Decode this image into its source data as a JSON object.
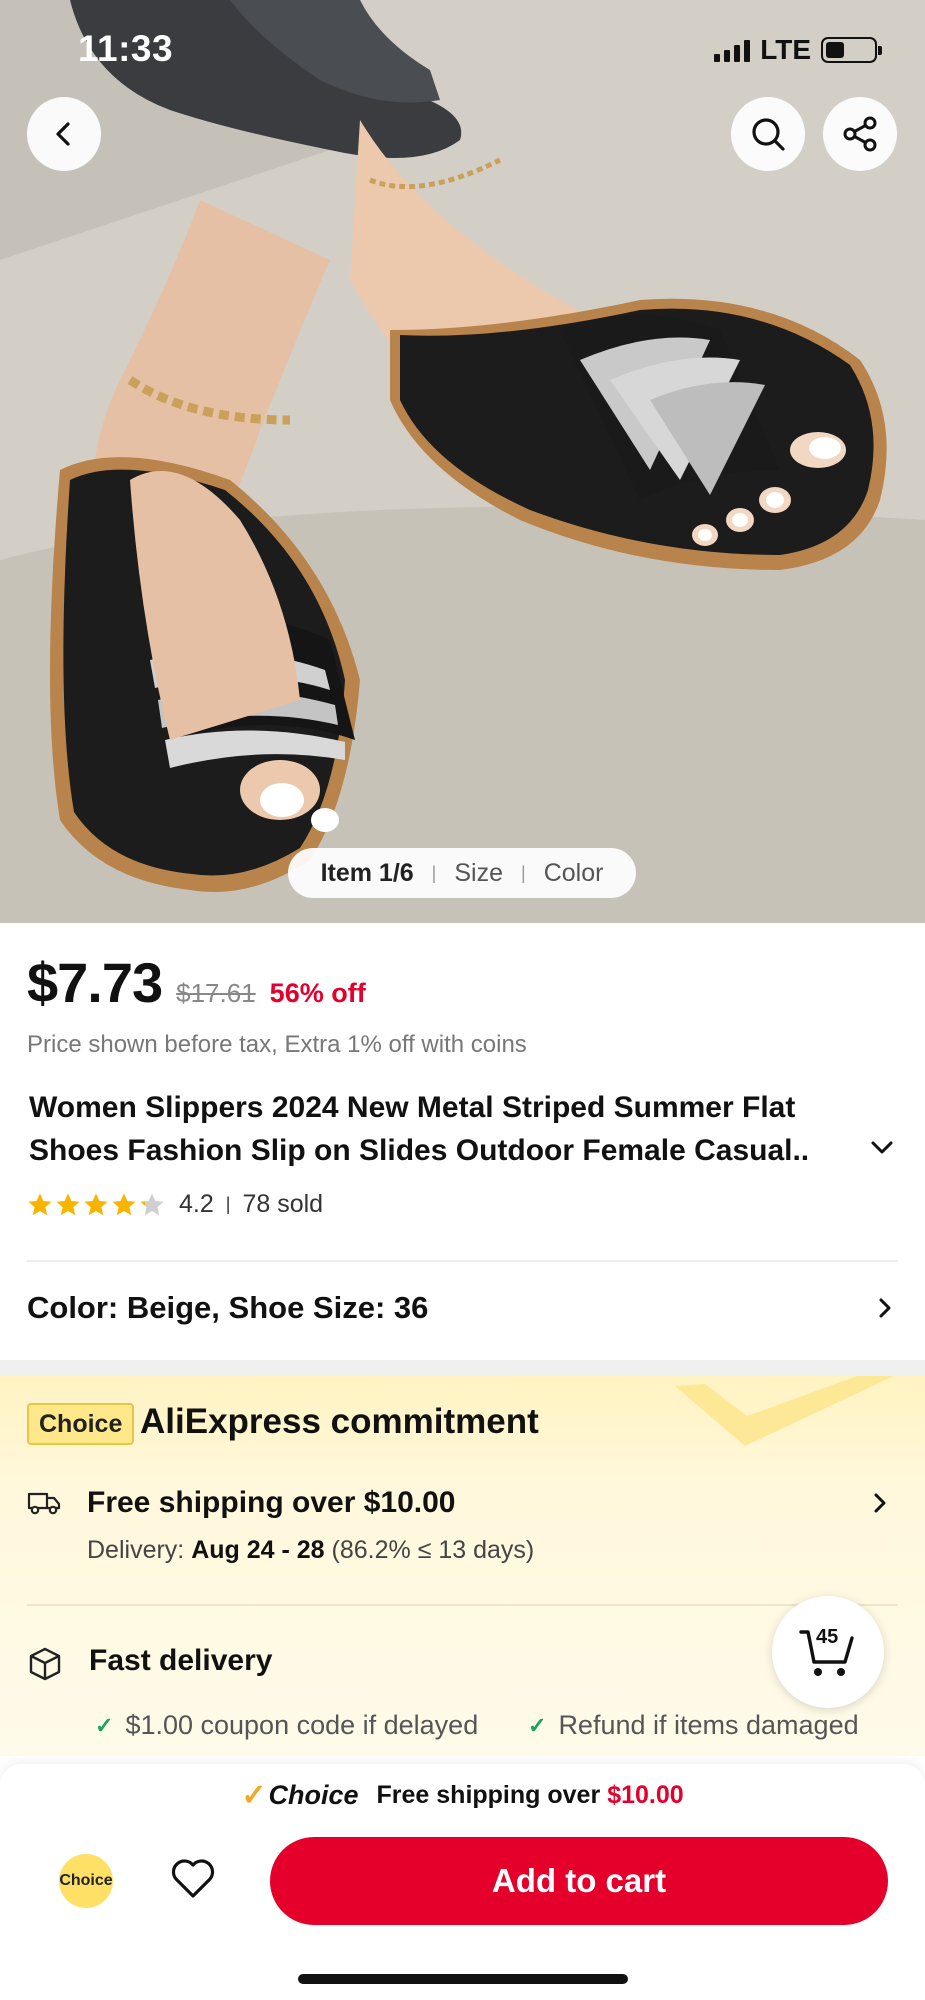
{
  "status_bar": {
    "time": "11:33",
    "network": "LTE"
  },
  "gallery": {
    "pager_item": "Item 1/6",
    "pager_size": "Size",
    "pager_color": "Color",
    "icons": [
      "back-arrow-icon",
      "search-icon",
      "share-icon"
    ]
  },
  "price": {
    "current": "$7.73",
    "original": "$17.61",
    "discount": "56% off",
    "note": "Price shown before tax, Extra 1% off with coins"
  },
  "product": {
    "title": "Women Slippers 2024 New Metal Striped Summer Flat Shoes Fashion Slip on Slides Outdoor Female Casual..",
    "rating": "4.2",
    "rating_stars": 4.2,
    "sold": "78 sold"
  },
  "variant": {
    "label": "Color: Beige, Shoe Size: 36"
  },
  "commitment": {
    "badge": "Choice",
    "title": "AliExpress commitment",
    "shipping_title": "Free shipping over $10.00",
    "delivery_label": "Delivery:",
    "delivery_dates": "Aug 24 - 28",
    "delivery_stats": "(86.2% ≤ 13 days)",
    "fast_title": "Fast delivery",
    "perk_1": "$1.00 coupon code if delayed",
    "perk_2": "Refund if items damaged"
  },
  "cart": {
    "count": "45"
  },
  "bottom_bar": {
    "promo_choice": "Choice",
    "promo_text": "Free shipping over",
    "promo_amount": "$10.00",
    "choice_circle": "Choice",
    "add_to_cart": "Add to cart"
  },
  "colors": {
    "accent_red": "#e4002b",
    "choice_yellow": "#ffe066",
    "star_gold": "#f7b500",
    "check_green": "#1aa260"
  }
}
